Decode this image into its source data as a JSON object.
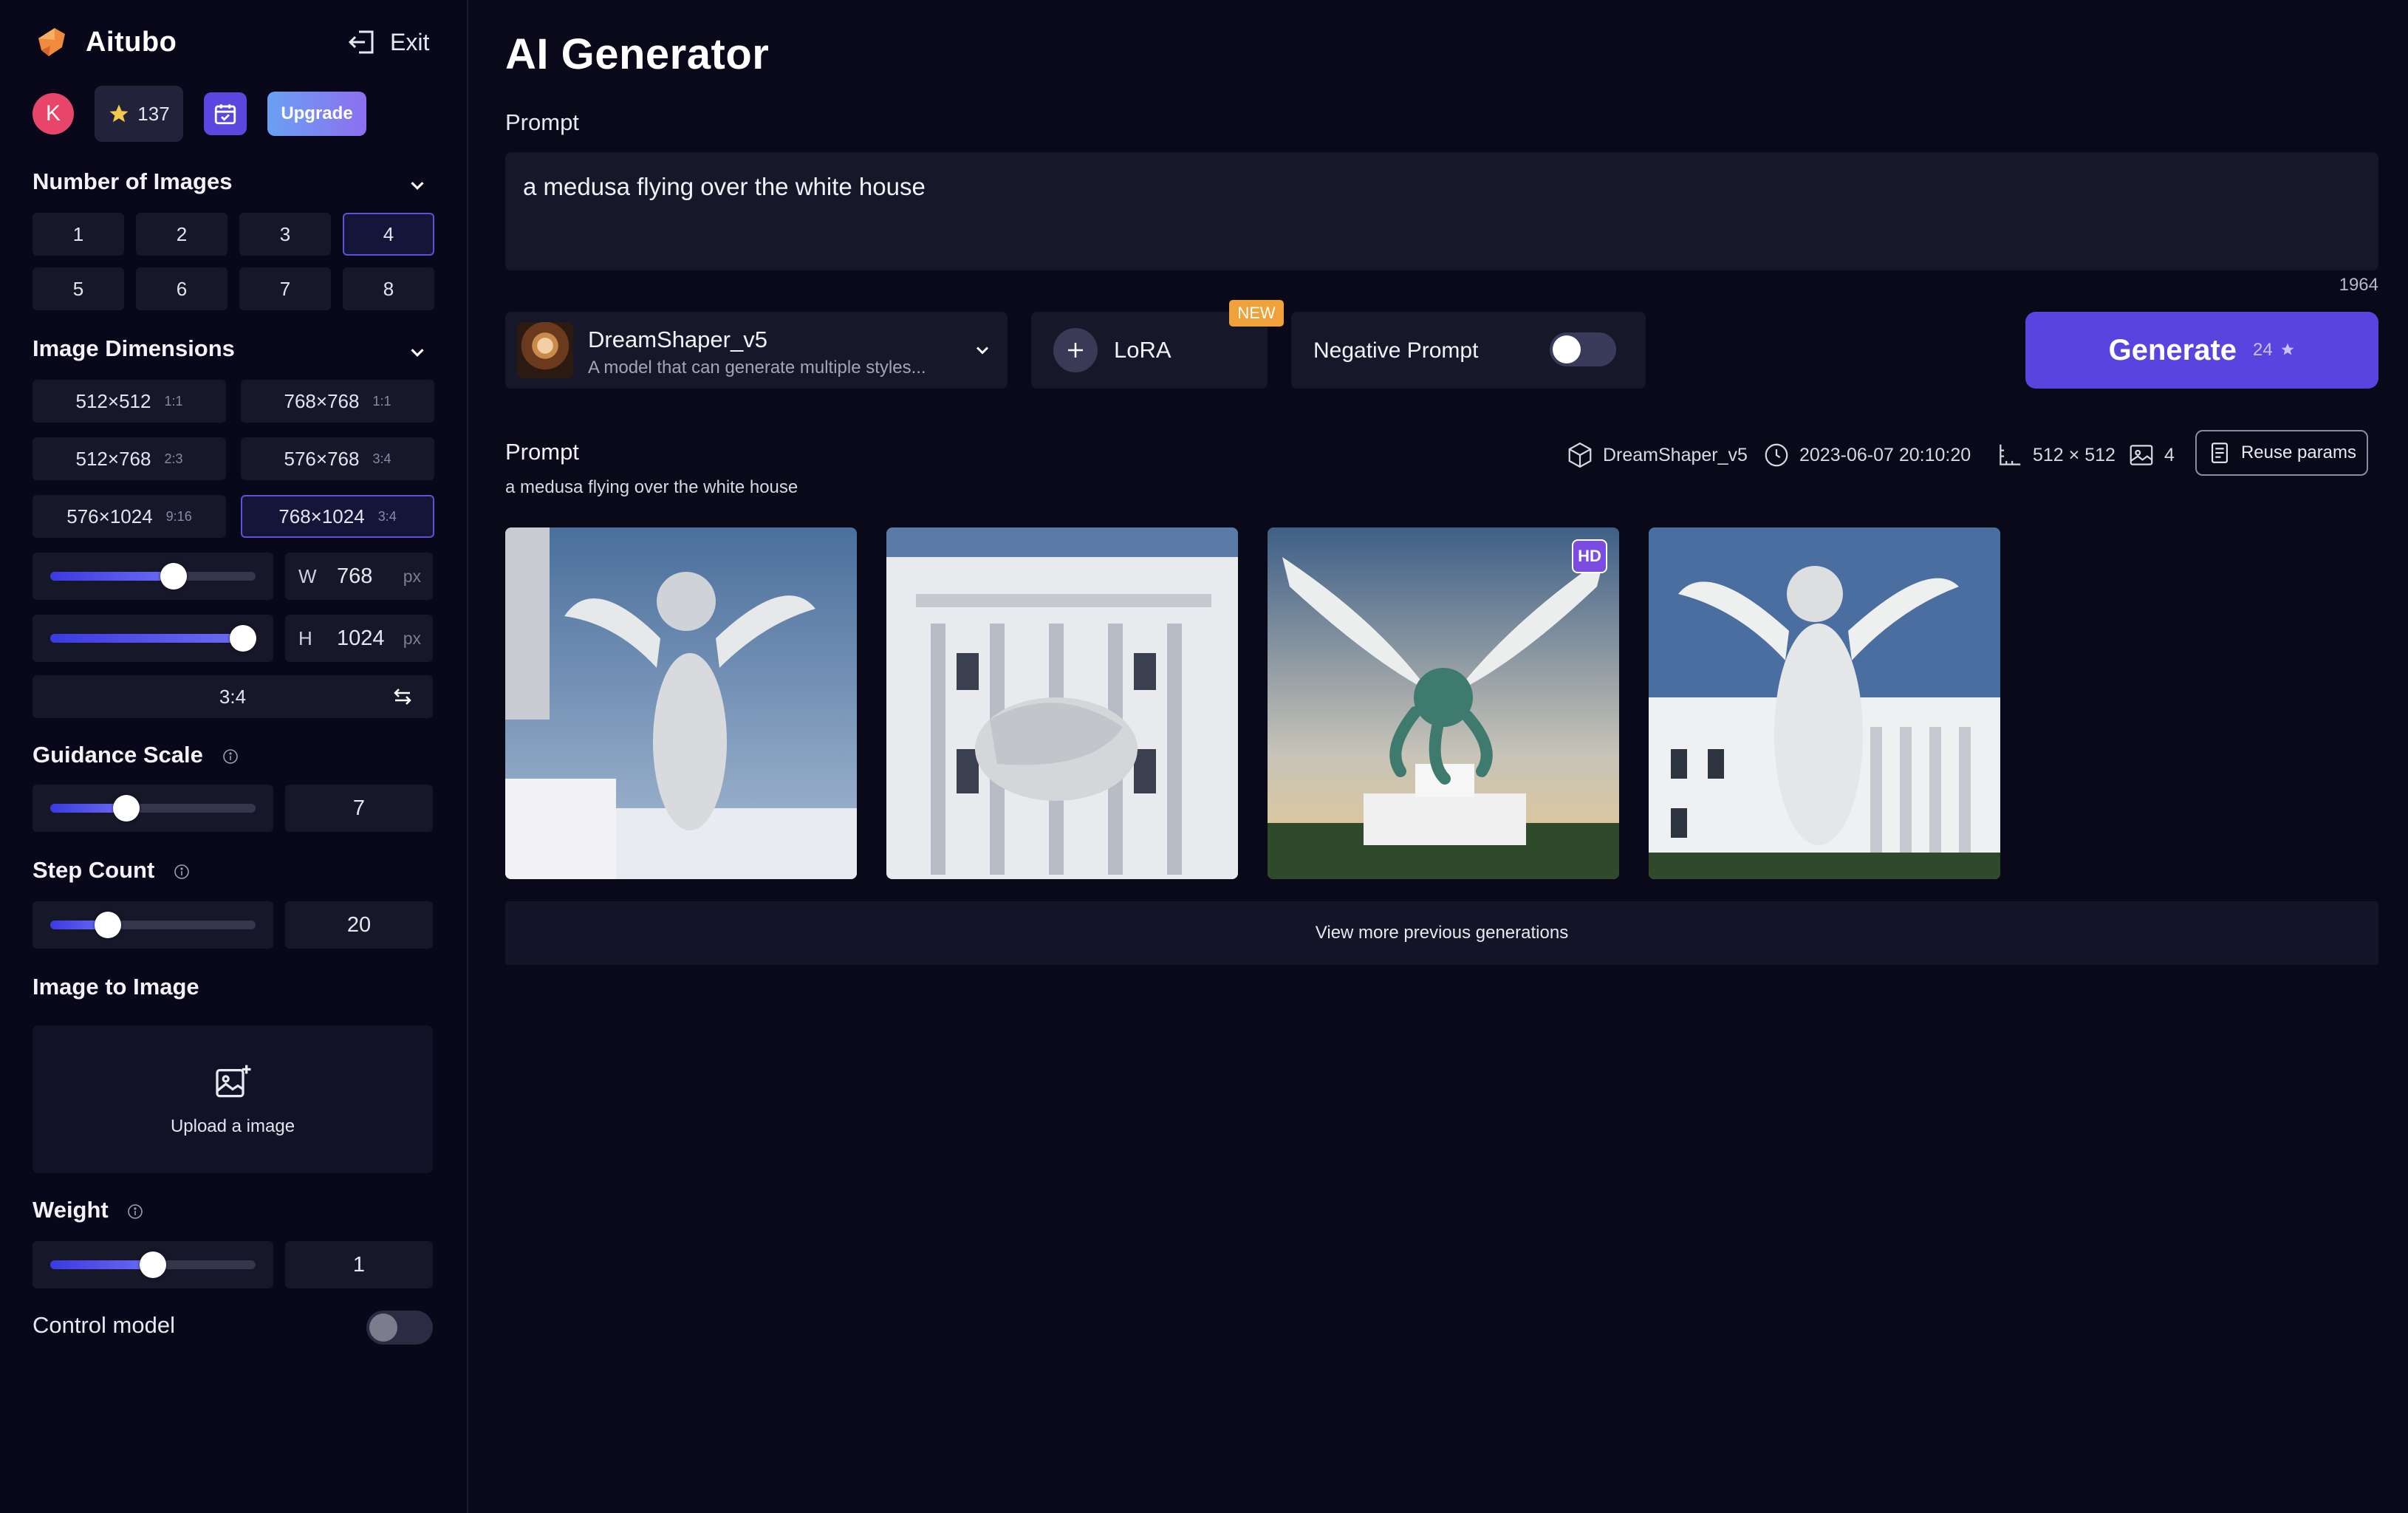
{
  "sidebar": {
    "brand": {
      "name": "Aitubo"
    },
    "exit_label": "Exit",
    "user": {
      "avatar_letter": "K",
      "credits": "137",
      "upgrade_label": "Upgrade"
    },
    "num_images": {
      "title": "Number of Images",
      "options": [
        "1",
        "2",
        "3",
        "4",
        "5",
        "6",
        "7",
        "8"
      ],
      "selected": "4"
    },
    "dimensions": {
      "title": "Image Dimensions",
      "options": [
        {
          "size": "512×512",
          "ratio": "1:1"
        },
        {
          "size": "768×768",
          "ratio": "1:1"
        },
        {
          "size": "512×768",
          "ratio": "2:3"
        },
        {
          "size": "576×768",
          "ratio": "3:4"
        },
        {
          "size": "576×1024",
          "ratio": "9:16"
        },
        {
          "size": "768×1024",
          "ratio": "3:4"
        }
      ],
      "selected": "768×1024",
      "width": {
        "label": "W",
        "value": "768",
        "unit": "px",
        "slider_fraction": 0.6
      },
      "height": {
        "label": "H",
        "value": "1024",
        "unit": "px",
        "slider_fraction": 0.94
      },
      "aspect": "3:4"
    },
    "guidance": {
      "title": "Guidance Scale",
      "value": "7",
      "slider_fraction": 0.37
    },
    "steps": {
      "title": "Step Count",
      "value": "20",
      "slider_fraction": 0.28
    },
    "img2img": {
      "title": "Image to Image",
      "upload_label": "Upload a image"
    },
    "weight": {
      "title": "Weight",
      "value": "1",
      "slider_fraction": 0.5
    },
    "control_model": {
      "label": "Control model",
      "enabled": false
    }
  },
  "main": {
    "title": "AI Generator",
    "prompt_label": "Prompt",
    "prompt_value": "a medusa flying over the white house",
    "char_count": "1964",
    "model": {
      "name": "DreamShaper_v5",
      "desc": "A model that can generate multiple styles..."
    },
    "lora": {
      "label": "LoRA",
      "badge": "NEW"
    },
    "negative_prompt": {
      "label": "Negative Prompt",
      "enabled": false
    },
    "generate": {
      "label": "Generate",
      "cost": "24"
    },
    "history": {
      "title": "Prompt",
      "prompt": "a medusa flying over the white house",
      "model": "DreamShaper_v5",
      "timestamp": "2023-06-07 20:10:20",
      "size": "512 × 512",
      "count": "4",
      "reuse_label": "Reuse params",
      "hd_badge": "HD",
      "view_more_label": "View more previous generations"
    }
  },
  "colors": {
    "accent": "#5a44df",
    "background": "#09091a",
    "panel": "#17172a",
    "badge_new": "#f0a23a"
  }
}
